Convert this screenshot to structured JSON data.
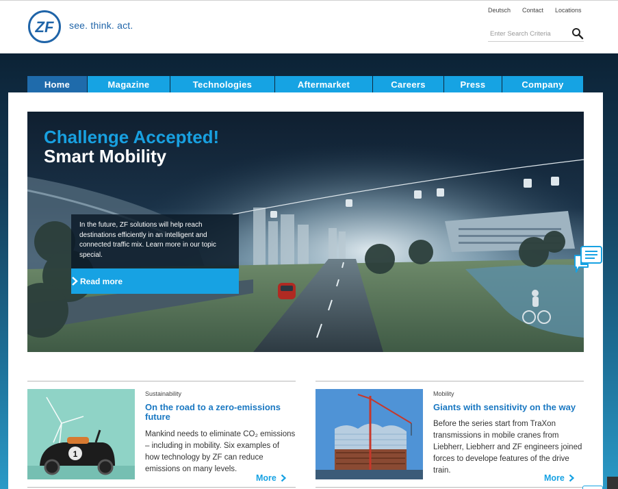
{
  "brand": {
    "slogan": "see. think. act.",
    "primary_color": "#1f64a8",
    "accent_color": "#17a2e3"
  },
  "meta_nav": [
    "Deutsch",
    "Contact",
    "Locations"
  ],
  "search": {
    "placeholder": "Enter Search Criteria"
  },
  "nav": {
    "tabs": [
      {
        "label": "Home",
        "active": true
      },
      {
        "label": "Magazine"
      },
      {
        "label": "Technologies"
      },
      {
        "label": "Aftermarket"
      },
      {
        "label": "Careers"
      },
      {
        "label": "Press"
      },
      {
        "label": "Company"
      }
    ]
  },
  "hero": {
    "headline1": "Challenge Accepted!",
    "headline2": "Smart Mobility",
    "teaser": "In the future, ZF solutions will help reach destinations efficiently in an intelligent and connected traffic mix. Learn more in our topic special.",
    "cta": "Read more"
  },
  "cards": [
    {
      "category": "Sustainability",
      "title": "On the road to a zero-emissions future",
      "desc": "Mankind needs to eliminate CO₂ emissions – including in mobility. Six examples of how technology by ZF can reduce emissions on many levels.",
      "more": "More"
    },
    {
      "category": "Mobility",
      "title": "Giants with sensitivity on the way",
      "desc": "Before the series start from TraXon transmissions in mobile cranes from Liebherr, Liebherr and ZF engineers joined forces to develope features of the drive train.",
      "more": "More"
    }
  ]
}
